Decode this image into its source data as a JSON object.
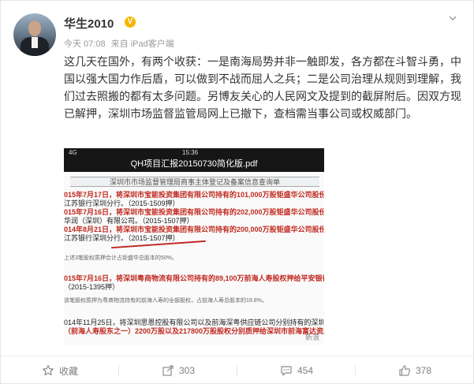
{
  "user": {
    "name": "华生2010",
    "badge": "V",
    "time": "今天 07:08",
    "source": "来自 iPad客户端"
  },
  "post": {
    "text": "这几天在国外，有两个收获：一是南海局势并非一触即发，各方都在斗智斗勇，中国以强大国力作后盾，可以做到不战而屈人之兵；二是公司治理从规则到理解，我们过去照搬的都有太多问题。另博友关心的人民网文及提到的截屏附后。因双方现已解押，深圳市场监督监管局网上已撤下，查档需当事公司或权威部门。"
  },
  "attachment": {
    "signal": "4G",
    "clock": "15:36",
    "pdf_title": "QH项目汇报20150730简化版.pdf",
    "doc_header": "深圳市市场监督管理局商事主体登记及备案信息查询单",
    "lines": [
      {
        "text": "015年7月17日，将深圳市宝能投资集团有限公司持有的101,000万股钜盛华公司股份质押",
        "style": "red"
      },
      {
        "text": "江苏银行深圳分行。（2015-1509押）",
        "style": "normal"
      },
      {
        "text": "015年7月16日，将深圳市宝能投资集团有限公司持有的202,000万股钜盛华公司股份质押",
        "style": "red"
      },
      {
        "text": "华润（深圳）有限公司。（2015-1507押）",
        "style": "normal"
      },
      {
        "text": "014年8月21日，将深圳市宝能投资集团有限公司持有的200,000万股钜盛华公司股份质押",
        "style": "red"
      },
      {
        "text": "江苏银行深圳分行。（2015-1507押）",
        "style": "normal"
      },
      {
        "text": "上述3笔股权质押合计占钜盛华总股本的50%。",
        "style": "small"
      },
      {
        "text": "015年7月16日，将深圳粤商物流有限公司持有的89,100万前海人寿股权押给平安银行深",
        "style": "red"
      },
      {
        "text": "（2015-1395押）",
        "style": "normal"
      },
      {
        "text": "该笔股权质押为粤商物流持有的前海人寿的全部股权，占前海人寿总股本的19.8%。",
        "style": "small"
      },
      {
        "text": "014年11月25日，将深圳思恩控股有限公司以及前海深粤供应链公司分别持有的深圳市",
        "style": "normal"
      },
      {
        "text": "（前海人寿股东之一）2200万股以及217800万股股权分别质押给深圳市前海富达资产",
        "style": "red"
      }
    ],
    "watermark": "新浪"
  },
  "actions": [
    {
      "label": "收藏",
      "icon": "star-icon"
    },
    {
      "label": "303",
      "icon": "share-icon"
    },
    {
      "label": "454",
      "icon": "comment-icon"
    },
    {
      "label": "378",
      "icon": "thumbs-up-icon"
    }
  ]
}
